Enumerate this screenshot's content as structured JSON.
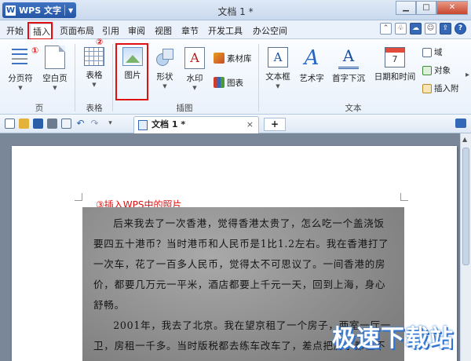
{
  "app": {
    "menu_label": "WPS 文字",
    "logo_letter": "W",
    "doc_title": "文档 1 *"
  },
  "menubar": {
    "tabs": [
      "开始",
      "插入",
      "页面布局",
      "引用",
      "审阅",
      "视图",
      "章节",
      "开发工具",
      "办公空间"
    ],
    "active_tab": "插入"
  },
  "ribbon": {
    "groups": {
      "page": {
        "label": "页",
        "buttons": [
          "分页符",
          "空白页"
        ]
      },
      "table": {
        "label": "表格",
        "buttons": [
          "表格"
        ]
      },
      "illustration": {
        "label": "插图",
        "buttons": [
          "图片",
          "形状",
          "水印"
        ],
        "side_items": [
          "素材库",
          "图表"
        ]
      },
      "text": {
        "label": "文本",
        "buttons": [
          "文本框",
          "艺术字",
          "首字下沉",
          "日期和时间"
        ],
        "side_items": [
          "域",
          "对象",
          "插入附"
        ]
      }
    },
    "annotations": [
      "①",
      "②"
    ]
  },
  "quickbar": {
    "doc_tab": "文档 1 *",
    "close_glyph": "×",
    "new_tab_glyph": "+"
  },
  "document": {
    "caption": "③插入WPS中的照片",
    "photo_text": [
      "后来我去了一次香港，觉得香港太贵了，怎么吃一个盖浇饭要四五十港币？当时港币和人民币是1比1.2左右。我在香港打了一次车，花了一百多人民币，觉得太不可思议了。一间香港的房价，都要几万元一平米，酒店都要上千元一天，回到上海，身心舒畅。",
      "2001年，我去了北京。我在望京租了一个房子，两室一厅一卫，房租一千多。当时版税都去练车改车了，差点把房子都租不"
    ],
    "watermark": "极速下载站"
  },
  "colors": {
    "highlight": "#e01010",
    "accent": "#3569b7"
  }
}
